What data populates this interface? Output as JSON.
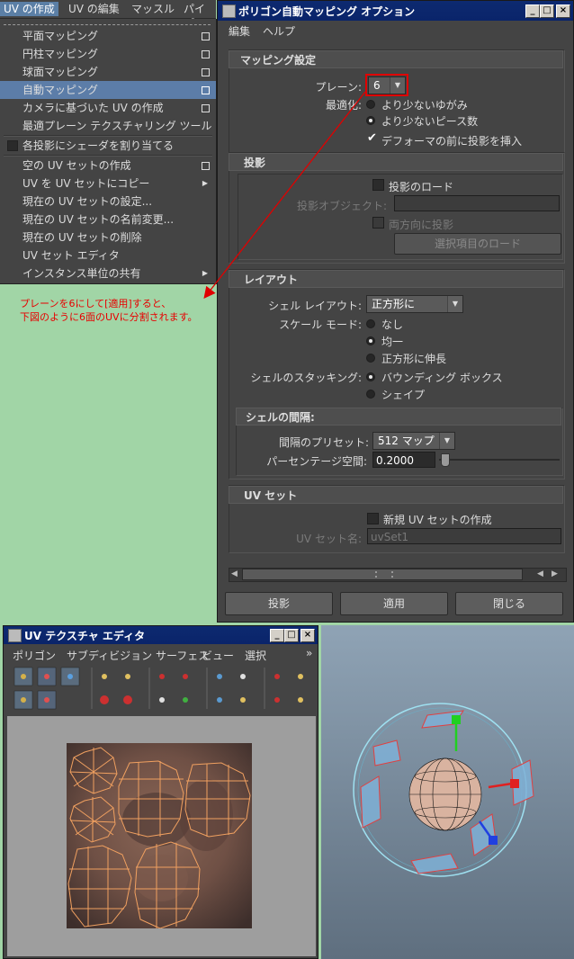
{
  "uv_menu": {
    "menubar": [
      "UV の作成",
      "UV の編集",
      "マッスル",
      "パイプ"
    ],
    "items": [
      {
        "label": "平面マッピング",
        "option": "box"
      },
      {
        "label": "円柱マッピング",
        "option": "box"
      },
      {
        "label": "球面マッピング",
        "option": "box"
      },
      {
        "label": "自動マッピング",
        "option": "box",
        "highlighted": true
      },
      {
        "label": "カメラに基づいた UV の作成",
        "option": "box"
      },
      {
        "label": "最適プレーン テクスチャリング ツール",
        "option": ""
      },
      {
        "label": "各投影にシェーダを割り当てる",
        "option": "checkbox"
      },
      {
        "label": "空の UV セットの作成",
        "option": "box"
      },
      {
        "label": "UV を UV セットにコピー",
        "option": "arrow"
      },
      {
        "label": "現在の UV セットの設定...",
        "option": ""
      },
      {
        "label": "現在の UV セットの名前変更...",
        "option": ""
      },
      {
        "label": "現在の UV セットの削除",
        "option": ""
      },
      {
        "label": "UV セット エディタ",
        "option": ""
      },
      {
        "label": "インスタンス単位の共有",
        "option": "arrow"
      }
    ]
  },
  "annotation": {
    "line1": "プレーンを6にして[適用]すると、",
    "line2": "下図のように6面のUVに分割されます。",
    "color": "#e80000"
  },
  "options_window": {
    "title": "ポリゴン自動マッピング オプション",
    "menu": [
      "編集",
      "ヘルプ"
    ],
    "mapping": {
      "header": "マッピング設定",
      "planes_label": "プレーン:",
      "planes_value": "6",
      "optimize_label": "最適化:",
      "optimize_opt1": "より少ないゆがみ",
      "optimize_opt2": "より少ないピース数",
      "deformer_label": "デフォーマの前に投影を挿入"
    },
    "projection": {
      "header": "投影",
      "load_projection": "投影のロード",
      "projection_object_label": "投影オブジェクト:",
      "project_both": "両方向に投影",
      "load_selected": "選択項目のロード"
    },
    "layout": {
      "header": "レイアウト",
      "shell_layout_label": "シェル レイアウト:",
      "shell_layout_value": "正方形に",
      "scale_mode_label": "スケール モード:",
      "scale_none": "なし",
      "scale_uniform": "均一",
      "scale_stretch": "正方形に伸長",
      "stacking_label": "シェルのスタッキング:",
      "stack_bbox": "バウンディング ボックス",
      "stack_shape": "シェイプ"
    },
    "spacing": {
      "header": "シェルの間隔:",
      "preset_label": "間隔のプリセット:",
      "preset_value": "512 マップ",
      "percent_label": "パーセンテージ空間:",
      "percent_value": "0.2000"
    },
    "uvset": {
      "header": "UV セット",
      "new_uvset": "新規 UV セットの作成",
      "uvset_name_label": "UV セット名:",
      "uvset_name_value": "uvSet1"
    },
    "buttons": {
      "project": "投影",
      "apply": "適用",
      "close": "閉じる"
    }
  },
  "uv_editor": {
    "title": "UV テクスチャ エディタ",
    "menu": [
      "ポリゴン",
      "サブディビジョン サーフェス",
      "ビュー",
      "選択"
    ],
    "more": "»"
  },
  "colors": {
    "panel_bg": "#444444",
    "title_blue": "#0a246a",
    "highlight": "#5c7da8",
    "annotation_red": "#e80000",
    "desktop_green": "#a1d5a6"
  }
}
